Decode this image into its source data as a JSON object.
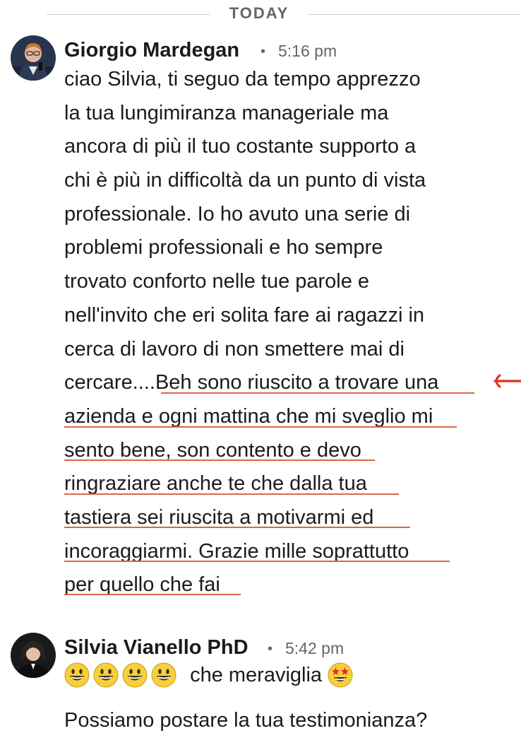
{
  "date_divider": "TODAY",
  "messages": [
    {
      "sender": "Giorgio Mardegan",
      "time": "5:16 pm",
      "lines": [
        "ciao Silvia, ti seguo da tempo apprezzo",
        "la tua lungimiranza manageriale ma",
        "ancora di più il tuo costante supporto a",
        "chi è più in difficoltà da un punto di vista",
        "professionale.  Io ho avuto una serie di",
        "problemi professionali e ho sempre",
        "trovato conforto nelle tue parole e",
        "nell'invito che eri solita fare ai ragazzi in",
        "cerca di lavoro di non smettere mai di"
      ],
      "line10_prefix": "cercare....",
      "highlighted_lines": [
        "Beh sono riuscito a trovare una",
        "azienda e ogni mattina che mi sveglio mi",
        "sento bene, son contento e devo",
        "ringraziare anche te che dalla tua",
        "tastiera sei riuscita a motivarmi ed",
        "incoraggiarmi. Grazie mille soprattutto",
        "per quello che fai"
      ]
    },
    {
      "sender": "Silvia Vianello PhD",
      "time": "5:42 pm",
      "emoji_row_text": "che meraviglia",
      "second_line": "Possiamo postare la tua testimonianza?"
    }
  ],
  "colors": {
    "highlight_underline": "#e06449",
    "annotation_arrow": "#e0321f",
    "meta_text": "#666666"
  },
  "icons": {
    "separator": "dot",
    "annotation": "left-arrow",
    "emoji": [
      "grinning-face",
      "grinning-face",
      "grinning-face",
      "grinning-face",
      "star-struck-face"
    ]
  }
}
